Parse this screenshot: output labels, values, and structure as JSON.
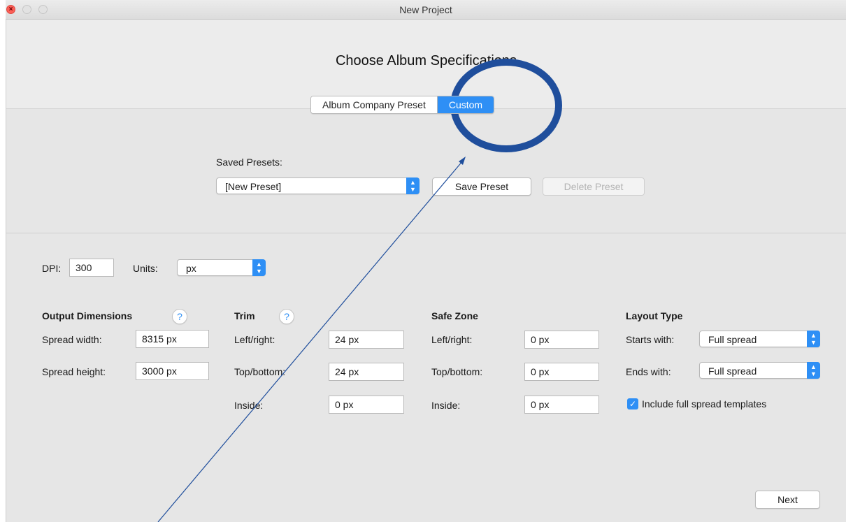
{
  "window": {
    "title": "New Project"
  },
  "header": {
    "heading": "Choose Album Specifications"
  },
  "mode_switch": {
    "options": [
      "Album Company Preset",
      "Custom"
    ],
    "selected": "Custom"
  },
  "presets": {
    "label": "Saved Presets:",
    "selected": "[New Preset]",
    "save_label": "Save Preset",
    "delete_label": "Delete Preset"
  },
  "settings": {
    "dpi_label": "DPI:",
    "dpi_value": "300",
    "units_label": "Units:",
    "units_value": "px"
  },
  "output": {
    "heading": "Output Dimensions",
    "width_label": "Spread width:",
    "width_value": "8315 px",
    "height_label": "Spread height:",
    "height_value": "3000 px"
  },
  "trim": {
    "heading": "Trim",
    "leftright_label": "Left/right:",
    "leftright_value": "24 px",
    "topbottom_label": "Top/bottom:",
    "topbottom_value": "24 px",
    "inside_label": "Inside:",
    "inside_value": "0 px"
  },
  "safe_zone": {
    "heading": "Safe Zone",
    "leftright_label": "Left/right:",
    "leftright_value": "0 px",
    "topbottom_label": "Top/bottom:",
    "topbottom_value": "0 px",
    "inside_label": "Inside:",
    "inside_value": "0 px"
  },
  "layout": {
    "heading": "Layout Type",
    "starts_label": "Starts with:",
    "starts_value": "Full spread",
    "ends_label": "Ends with:",
    "ends_value": "Full spread",
    "include_label": "Include full spread templates",
    "include_checked": true
  },
  "help_glyph": "?",
  "footer": {
    "next_label": "Next"
  },
  "annotation": {
    "color": "#1f4e9c"
  },
  "colors": {
    "accent": "#2e8ff5"
  },
  "icons": {
    "popup_arrow": "chevron-up-down-icon",
    "check": "checkmark-icon",
    "help": "question-mark-icon"
  }
}
